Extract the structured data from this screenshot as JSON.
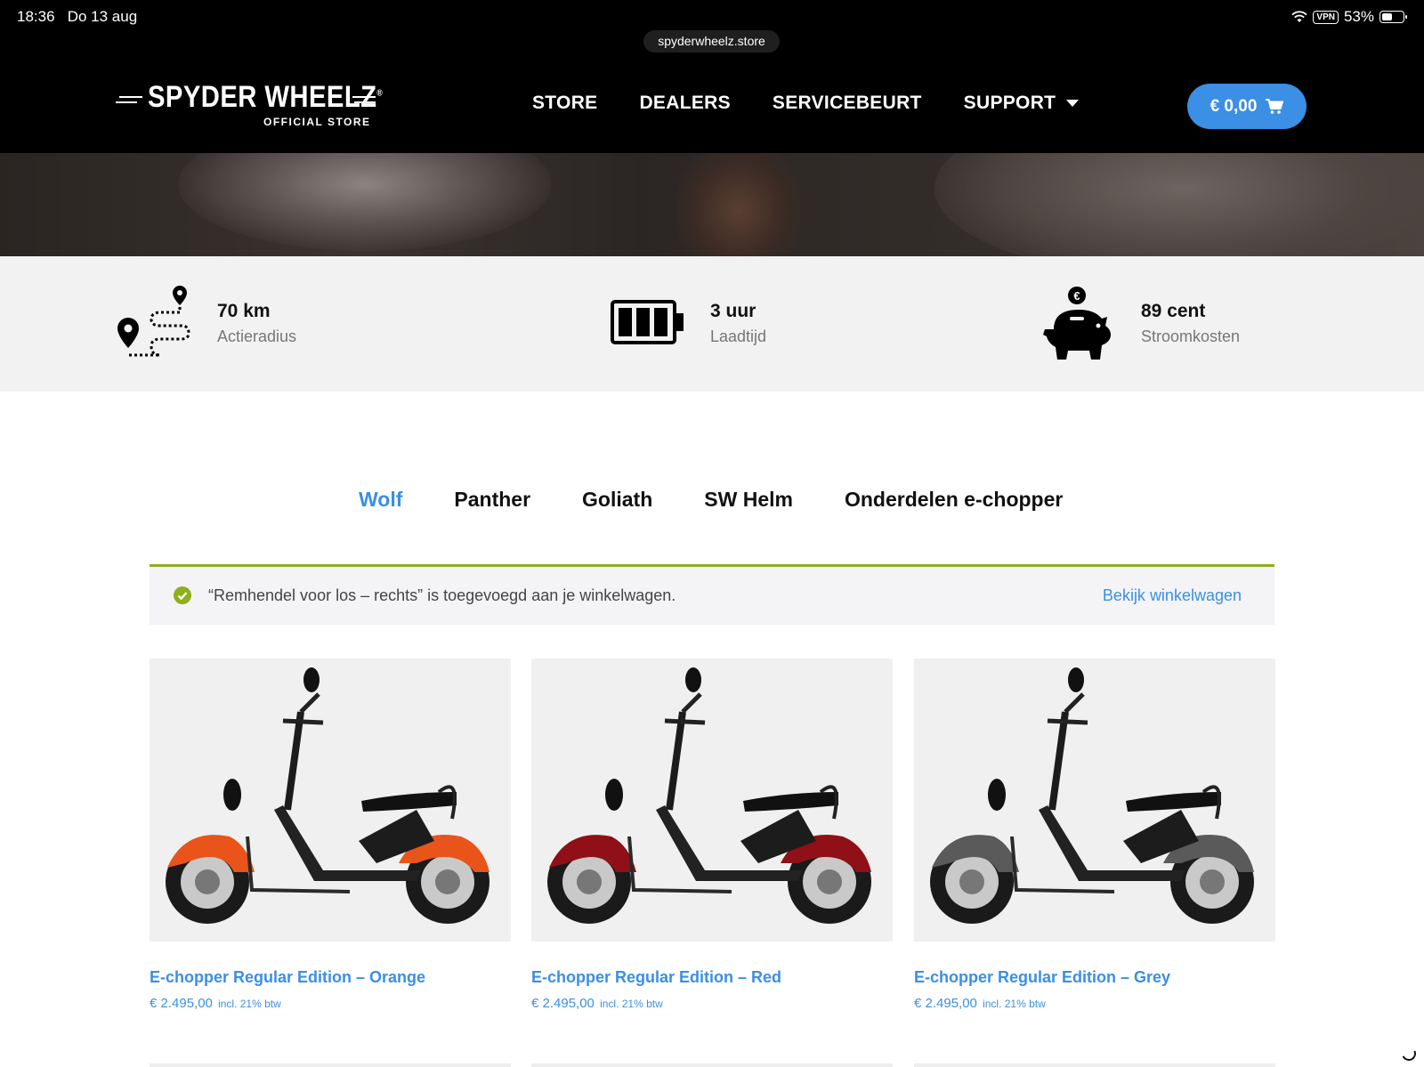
{
  "status_bar": {
    "time": "18:36",
    "date": "Do 13 aug",
    "vpn": "VPN",
    "battery_text": "53%",
    "battery_level": 0.53
  },
  "browser": {
    "url": "spyderwheelz.store"
  },
  "header": {
    "logo_title": "SPYDER WHEELZ",
    "logo_trademark": "®",
    "logo_subtitle": "OFFICIAL STORE",
    "nav": [
      {
        "label": "STORE"
      },
      {
        "label": "DEALERS"
      },
      {
        "label": "SERVICEBEURT"
      },
      {
        "label": "SUPPORT"
      }
    ],
    "cart_label": "€ 0,00"
  },
  "features": [
    {
      "icon": "route-map-icon",
      "value": "70 km",
      "label": "Actieradius"
    },
    {
      "icon": "battery-icon",
      "value": "3 uur",
      "label": "Laadtijd"
    },
    {
      "icon": "piggy-bank-icon",
      "value": "89 cent",
      "label": "Stroomkosten",
      "badge": "€"
    }
  ],
  "tabs": [
    {
      "label": "Wolf",
      "active": true
    },
    {
      "label": "Panther",
      "active": false
    },
    {
      "label": "Goliath",
      "active": false
    },
    {
      "label": "SW Helm",
      "active": false
    },
    {
      "label": "Onderdelen e-chopper",
      "active": false
    }
  ],
  "notice": {
    "text": "“Remhendel voor los – rechts” is toegevoegd aan je winkelwagen.",
    "link": "Bekijk winkelwagen"
  },
  "products": [
    {
      "title": "E-chopper Regular Edition – Orange",
      "price": "€ 2.495,00",
      "tax": "incl. 21% btw",
      "color": "#e8541a"
    },
    {
      "title": "E-chopper Regular Edition – Red",
      "price": "€ 2.495,00",
      "tax": "incl. 21% btw",
      "color": "#8f1016"
    },
    {
      "title": "E-chopper Regular Edition – Grey",
      "price": "€ 2.495,00",
      "tax": "incl. 21% btw",
      "color": "#5a5a5a"
    }
  ],
  "colors": {
    "accent": "#3b8fe4",
    "success": "#8fae1b",
    "header_bg": "#000000"
  }
}
